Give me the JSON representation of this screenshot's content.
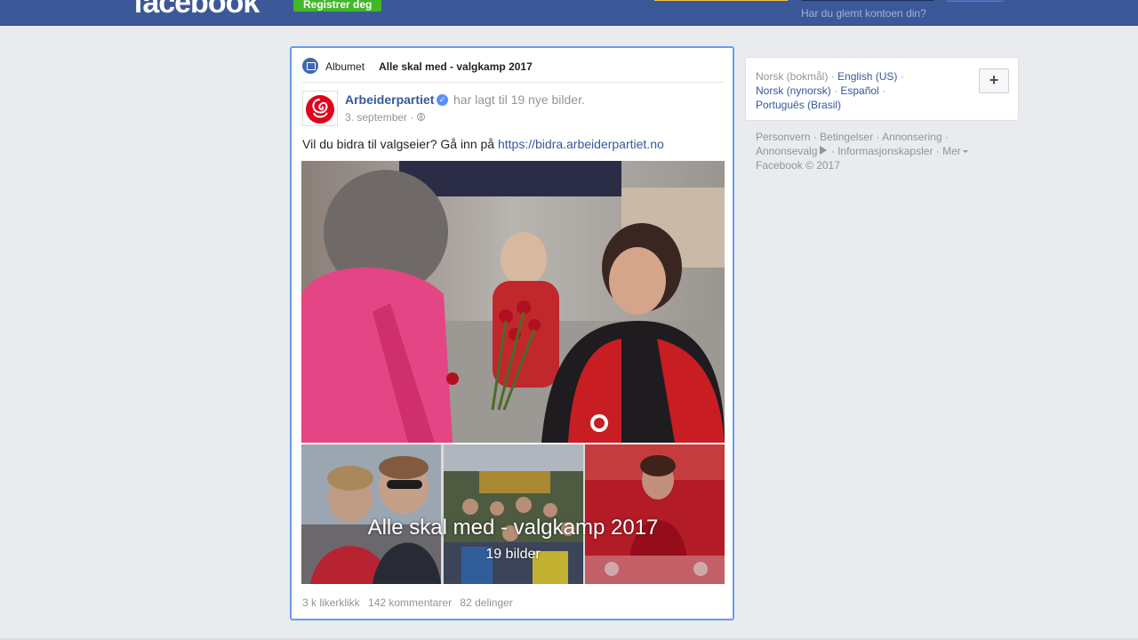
{
  "topbar": {
    "logo": "facebook",
    "register_label": "Registrer deg",
    "forgot_label": "Har du glemt kontoen din?"
  },
  "post": {
    "album_prefix": "Albumet",
    "album_title": "Alle skal med - valgkamp 2017",
    "author": "Arbeiderpartiet",
    "action": "har lagt til 19 nye bilder.",
    "date": "3. september",
    "date_sep": "·",
    "text": "Vil du bidra til valgseier? Gå inn på ",
    "link": "https://bidra.arbeiderpartiet.no",
    "overlay_title": "Alle skal med - valgkamp 2017",
    "overlay_count": "19 bilder",
    "stats": {
      "likes": "3 k likerklikk",
      "comments": "142 kommentarer",
      "shares": "82 delinger"
    }
  },
  "languages": {
    "current": "Norsk (bokmål)",
    "items": [
      "English (US)",
      "Norsk (nynorsk)",
      "Español",
      "Português (Brasil)"
    ],
    "sep": " · ",
    "add_label": "+"
  },
  "footer": {
    "links": [
      "Personvern",
      "Betingelser",
      "Annonsering",
      "Annonsevalg",
      "Informasjonskapsler",
      "Mer"
    ],
    "copyright": "Facebook © 2017"
  },
  "colors": {
    "topbar": "#3b5998",
    "link": "#365899",
    "register": "#42b72a",
    "highlight_border": "#6b9ded"
  },
  "icons": [
    "album-icon",
    "verified-icon",
    "globe-icon",
    "adchoices-icon",
    "caret-down-icon",
    "plus-icon"
  ]
}
